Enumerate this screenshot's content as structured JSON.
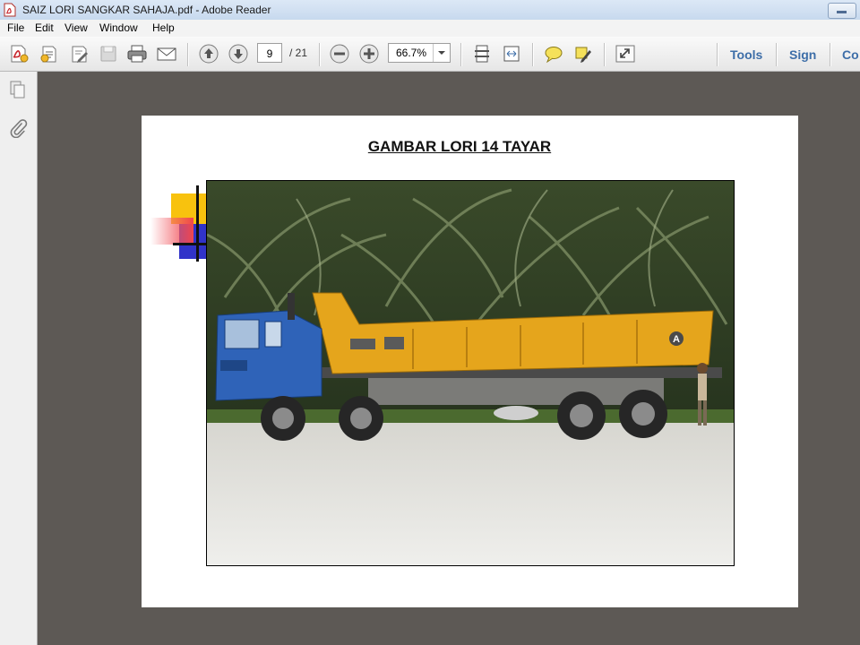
{
  "window": {
    "title": "SAIZ LORI SANGKAR SAHAJA.pdf - Adobe Reader"
  },
  "menu": [
    "File",
    "Edit",
    "View",
    "Window",
    "Help"
  ],
  "toolbar": {
    "page_current": "9",
    "page_total": "/ 21",
    "zoom": "66.7%",
    "links": [
      "Tools",
      "Sign",
      "Co"
    ]
  },
  "document": {
    "heading": "GAMBAR LORI 14 TAYAR",
    "truck_panel_badge": "A"
  },
  "colors": {
    "truck_body": "#e5a51c",
    "truck_cab": "#2f63b8",
    "link_blue": "#3d6ea8",
    "workspace": "#5d5955"
  },
  "icons": [
    "pdf-file-icon",
    "create-pdf-icon",
    "edit-icon",
    "sign-pen-icon",
    "save-icon",
    "print-icon",
    "email-icon",
    "arrow-up-icon",
    "arrow-down-icon",
    "zoom-out-icon",
    "zoom-in-icon",
    "fit-page-icon",
    "fit-width-icon",
    "comment-icon",
    "highlight-icon",
    "expand-icon",
    "pages-icon",
    "paperclip-icon"
  ]
}
